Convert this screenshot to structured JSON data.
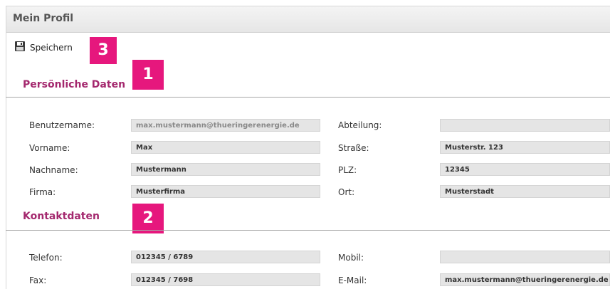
{
  "window": {
    "title": "Mein Profil"
  },
  "toolbar": {
    "save_label": "Speichern"
  },
  "badges": {
    "b1": "1",
    "b2": "2",
    "b3": "3"
  },
  "sections": {
    "personal": {
      "title": "Persönliche Daten"
    },
    "contact": {
      "title": "Kontaktdaten"
    }
  },
  "personal": {
    "username_label": "Benutzername:",
    "username_value": "max.mustermann@thueringerenergie.de",
    "firstname_label": "Vorname:",
    "firstname_value": "Max",
    "lastname_label": "Nachname:",
    "lastname_value": "Mustermann",
    "company_label": "Firma:",
    "company_value": "Musterfirma",
    "department_label": "Abteilung:",
    "department_value": "",
    "street_label": "Straße:",
    "street_value": "Musterstr. 123",
    "zip_label": "PLZ:",
    "zip_value": "12345",
    "city_label": "Ort:",
    "city_value": "Musterstadt"
  },
  "contact": {
    "phone_label": "Telefon:",
    "phone_value": "012345 / 6789",
    "fax_label": "Fax:",
    "fax_value": "012345 / 7698",
    "mobile_label": "Mobil:",
    "mobile_value": "",
    "email_label": "E-Mail:",
    "email_value": "max.mustermann@thueringerenergie.de"
  },
  "colors": {
    "accent": "#e6177d",
    "section_title": "#a4286e"
  },
  "icons": {
    "save": "floppy-disk-icon"
  }
}
